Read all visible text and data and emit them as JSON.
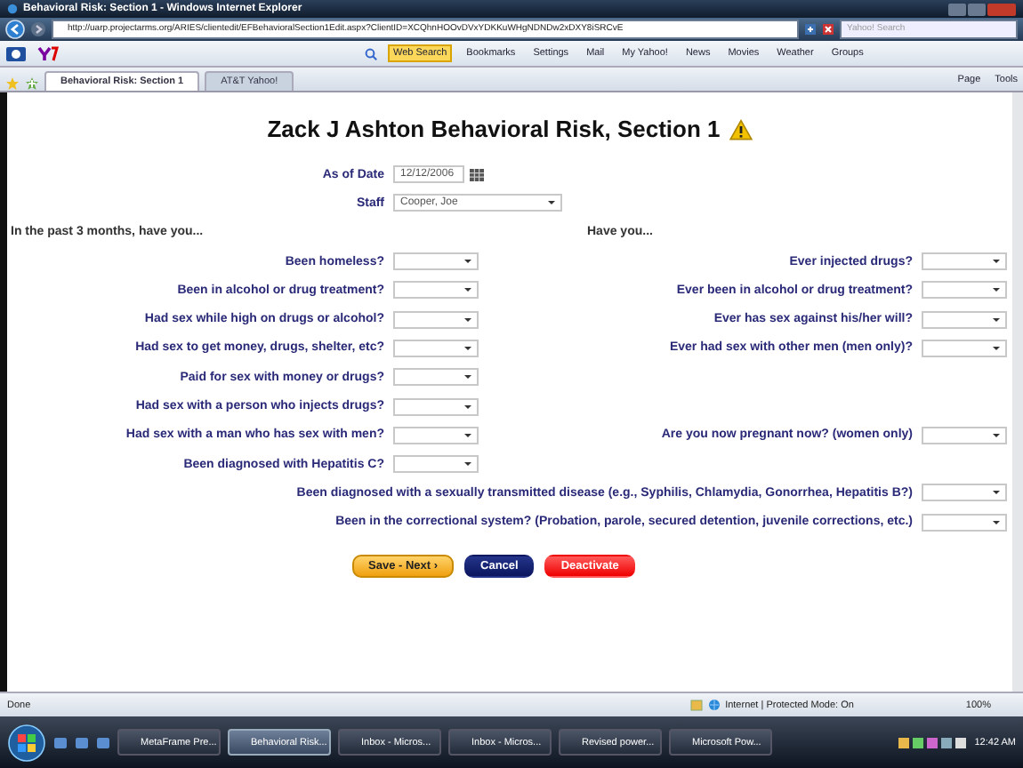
{
  "window": {
    "title": "Behavioral Risk: Section 1 - Windows Internet Explorer"
  },
  "address_bar": {
    "url": "http://uarp.projectarms.org/ARIES/clientedit/EFBehavioralSection1Edit.aspx?ClientID=XCQhnHOOvDVxYDKKuWHgNDNDw2xDXY8iSRCvE",
    "search_placeholder": "Yahoo! Search"
  },
  "toolbar": {
    "items": [
      "Web Search",
      "Bookmarks",
      "Settings",
      "Mail",
      "My Yahoo!",
      "News",
      "Movies",
      "Weather",
      "Groups"
    ]
  },
  "tabs": [
    {
      "label": "Behavioral Risk: Section 1",
      "selected": true
    },
    {
      "label": "AT&T Yahoo!",
      "selected": false
    }
  ],
  "command_bar": [
    "Page",
    "Tools"
  ],
  "form": {
    "title": "Zack J Ashton Behavioral Risk, Section 1",
    "as_of_date": {
      "label": "As of Date",
      "value": "12/12/2006"
    },
    "staff": {
      "label": "Staff",
      "value": "Cooper, Joe"
    },
    "left_heading": "In the past 3 months, have you...",
    "right_heading": "Have you...",
    "rows": [
      {
        "left": "Been homeless?",
        "right": "Ever injected drugs?"
      },
      {
        "left": "Been in alcohol or drug treatment?",
        "right": "Ever been in alcohol or drug treatment?"
      },
      {
        "left": "Had sex while high on drugs or alcohol?",
        "right": "Ever has sex against his/her will?"
      },
      {
        "left": "Had sex to get money, drugs, shelter, etc?",
        "right": "Ever had sex with other men (men only)?"
      },
      {
        "left": "Paid for sex with money or drugs?"
      },
      {
        "left": "Had sex with a person who injects drugs?"
      },
      {
        "left": "Had sex with a man who has sex with men?",
        "right": "Are you now pregnant now? (women only)"
      },
      {
        "left": "Been diagnosed with Hepatitis C?"
      }
    ],
    "wide_questions": [
      "Been diagnosed with a sexually transmitted disease (e.g., Syphilis, Chlamydia, Gonorrhea, Hepatitis B?)",
      "Been in the correctional system? (Probation, parole, secured detention, juvenile corrections, etc.)"
    ],
    "buttons": [
      {
        "label": "Save - Next ›",
        "kind": "save"
      },
      {
        "label": "Cancel",
        "kind": "cancel"
      },
      {
        "label": "Deactivate",
        "kind": "deactivate"
      }
    ]
  },
  "status_bar": {
    "text": "Done",
    "zone": "Internet | Protected Mode: On",
    "zoom": "100%"
  },
  "taskbar": {
    "items": [
      {
        "label": "MetaFrame Pre...",
        "selected": false
      },
      {
        "label": "Behavioral Risk...",
        "selected": true
      },
      {
        "label": "Inbox - Micros...",
        "selected": false
      },
      {
        "label": "Inbox - Micros...",
        "selected": false
      },
      {
        "label": "Revised power...",
        "selected": false
      },
      {
        "label": "Microsoft Pow...",
        "selected": false
      }
    ],
    "clock": "12:42 AM"
  }
}
